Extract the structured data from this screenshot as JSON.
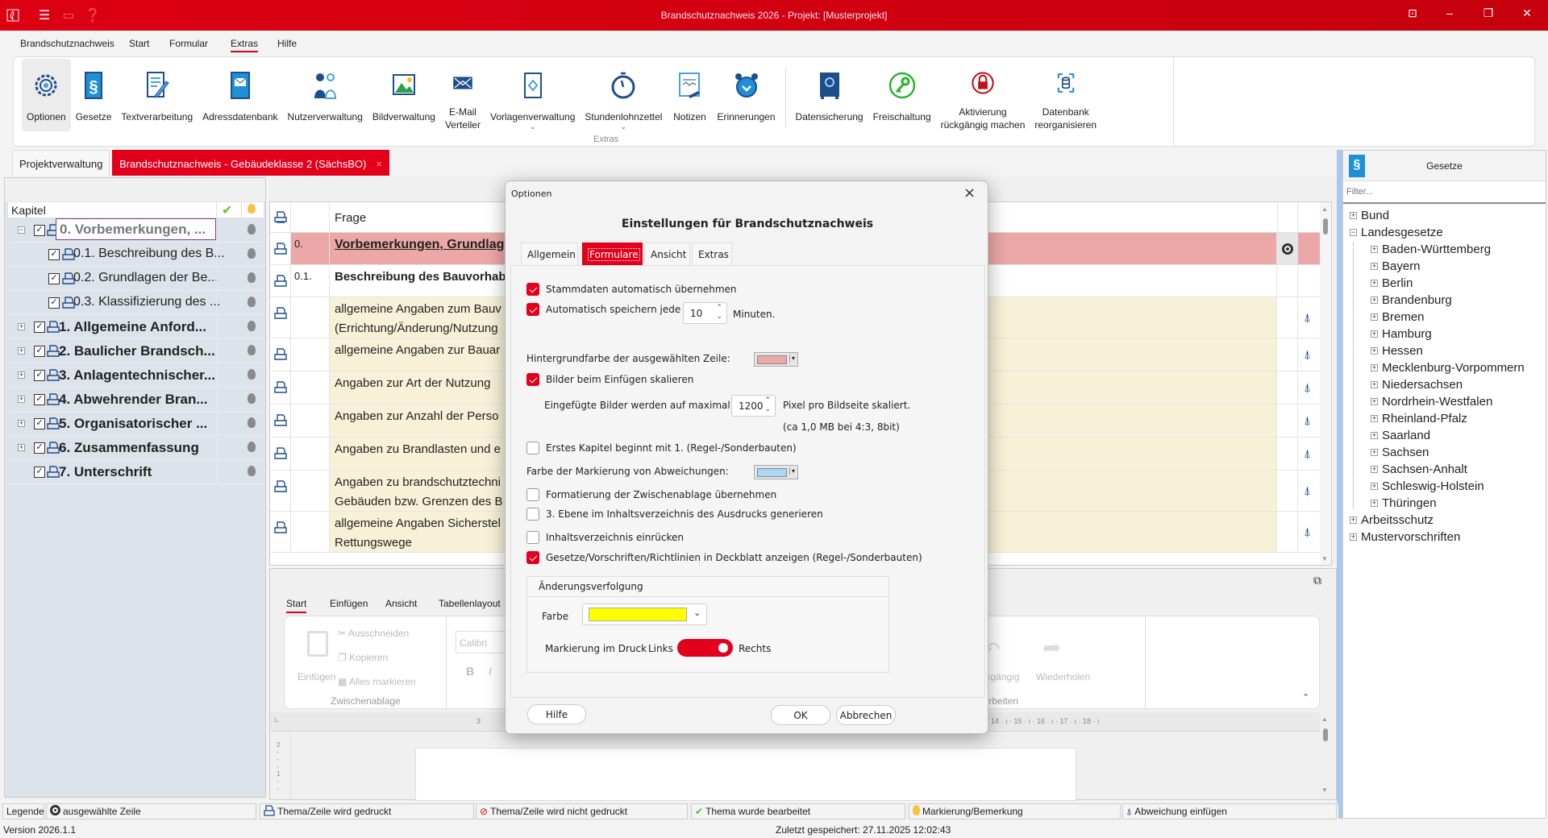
{
  "app": {
    "title": "Brandschutznachweis 2026 - Projekt: [Musterprojekt]",
    "quick_access": [
      "app-logo-icon",
      "menu-icon",
      "save-icon",
      "help-icon"
    ]
  },
  "menu": [
    "Brandschutznachweis",
    "Start",
    "Formular",
    "Extras",
    "Hilfe"
  ],
  "menu_active": "Extras",
  "ribbon": {
    "group_label": "Extras",
    "buttons": [
      {
        "label": "Optionen",
        "icon": "gear-icon",
        "selected": true
      },
      {
        "label": "Gesetze",
        "icon": "paragraph-icon"
      },
      {
        "label": "Textverarbeitung",
        "icon": "document-edit-icon"
      },
      {
        "label": "Adressdatenbank",
        "icon": "address-book-icon"
      },
      {
        "label": "Nutzerverwaltung",
        "icon": "users-icon"
      },
      {
        "label": "Bildverwaltung",
        "icon": "image-icon"
      },
      {
        "label": "E-Mail",
        "label2": "Verteiler",
        "icon": "mail-icon"
      },
      {
        "label": "Vorlagenverwaltung",
        "icon": "template-icon",
        "dropdown": true
      },
      {
        "label": "Stundenlohnzettel",
        "icon": "stopwatch-icon",
        "dropdown": true
      },
      {
        "label": "Notizen",
        "icon": "notes-icon"
      },
      {
        "label": "Erinnerungen",
        "icon": "alarm-icon",
        "separator_after": true
      },
      {
        "label": "Datensicherung",
        "icon": "safe-icon"
      },
      {
        "label": "Freischaltung",
        "icon": "key-icon"
      },
      {
        "label": "Aktivierung",
        "label2": "rückgängig machen",
        "icon": "lock-icon"
      },
      {
        "label": "Datenbank",
        "label2": "reorganisieren",
        "icon": "database-icon"
      }
    ]
  },
  "doc_tabs": [
    {
      "label": "Projektverwaltung"
    },
    {
      "label": "Brandschutznachweis - Gebäudeklasse 2 (SächsBO)",
      "active": true,
      "close": "×"
    }
  ],
  "chapters": {
    "header": "Kapitel",
    "items": [
      {
        "label": "0. Vorbemerkungen, ...",
        "level": 0,
        "expander": "−",
        "bold": true,
        "selected": true
      },
      {
        "label": "0.1. Beschreibung des B...",
        "level": 1
      },
      {
        "label": "0.2. Grundlagen der Be...",
        "level": 1
      },
      {
        "label": "0.3. Klassifizierung des ...",
        "level": 1
      },
      {
        "label": "1. Allgemeine Anford...",
        "level": 0,
        "expander": "+",
        "bold": true
      },
      {
        "label": "2. Baulicher Brandsch...",
        "level": 0,
        "expander": "+",
        "bold": true
      },
      {
        "label": "3. Anlagentechnischer...",
        "level": 0,
        "expander": "+",
        "bold": true
      },
      {
        "label": "4. Abwehrender Bran...",
        "level": 0,
        "expander": "+",
        "bold": true
      },
      {
        "label": "5. Organisatorischer ...",
        "level": 0,
        "expander": "+",
        "bold": true
      },
      {
        "label": "6. Zusammenfassung",
        "level": 0,
        "expander": "+",
        "bold": true
      },
      {
        "label": "7. Unterschrift",
        "level": 0,
        "bold": true
      }
    ]
  },
  "table": {
    "header": "Frage",
    "rows": [
      {
        "num": "0.",
        "lines": [
          "Vorbemerkungen, Grundlag"
        ],
        "style": "selected",
        "marker": true
      },
      {
        "num": "0.1.",
        "lines": [
          "Beschreibung des Bauvorhab"
        ],
        "style": "bold"
      },
      {
        "num": "",
        "lines": [
          "allgemeine Angaben zum Bauv",
          "(Errichtung/Änderung/Nutzung"
        ],
        "style": "yellow",
        "abw": true
      },
      {
        "num": "",
        "lines": [
          "allgemeine Angaben zur Bauar"
        ],
        "style": "yellow",
        "abw": true
      },
      {
        "num": "",
        "lines": [
          "Angaben zur Art der Nutzung"
        ],
        "style": "yellow",
        "abw": true
      },
      {
        "num": "",
        "lines": [
          "Angaben zur Anzahl der Perso"
        ],
        "style": "yellow",
        "abw": true
      },
      {
        "num": "",
        "lines": [
          "Angaben zu Brandlasten und e"
        ],
        "style": "yellow",
        "abw": true
      },
      {
        "num": "",
        "lines": [
          "Angaben zu brandschutztechni",
          "Gebäuden bzw. Grenzen des B"
        ],
        "style": "yellow",
        "abw": true
      },
      {
        "num": "",
        "lines": [
          "allgemeine Angaben Sicherstel",
          "Rettungswege"
        ],
        "style": "yellow",
        "abw": true
      }
    ]
  },
  "editor": {
    "tabs": [
      "Start",
      "Einfügen",
      "Ansicht",
      "Tabellenlayout"
    ],
    "paste": "Einfügen",
    "cut": "Ausschneiden",
    "copy": "Kopieren",
    "select_all": "Alles markieren",
    "clipboard_group": "Zwischenablage",
    "font": "Calibri",
    "bold": "B",
    "italic": "I",
    "undo": "Rückgängig",
    "redo": "Wiederholen",
    "edit_group": "Bearbeiten",
    "ruler_left": "3",
    "ruler_right": "14 · ı · 15 · ı · 16 · ı · 17 · ı · 18 · ı"
  },
  "laws": {
    "header": "Gesetze",
    "filter_placeholder": "Filter...",
    "items": [
      {
        "label": "Bund",
        "level": 0,
        "exp": "+"
      },
      {
        "label": "Landesgesetze",
        "level": 0,
        "exp": "−"
      },
      {
        "label": "Baden-Württemberg",
        "level": 1,
        "exp": "+"
      },
      {
        "label": "Bayern",
        "level": 1,
        "exp": "+"
      },
      {
        "label": "Berlin",
        "level": 1,
        "exp": "+"
      },
      {
        "label": "Brandenburg",
        "level": 1,
        "exp": "+"
      },
      {
        "label": "Bremen",
        "level": 1,
        "exp": "+"
      },
      {
        "label": "Hamburg",
        "level": 1,
        "exp": "+"
      },
      {
        "label": "Hessen",
        "level": 1,
        "exp": "+"
      },
      {
        "label": "Mecklenburg-Vorpommern",
        "level": 1,
        "exp": "+"
      },
      {
        "label": "Niedersachsen",
        "level": 1,
        "exp": "+"
      },
      {
        "label": "Nordrhein-Westfalen",
        "level": 1,
        "exp": "+"
      },
      {
        "label": "Rheinland-Pfalz",
        "level": 1,
        "exp": "+"
      },
      {
        "label": "Saarland",
        "level": 1,
        "exp": "+"
      },
      {
        "label": "Sachsen",
        "level": 1,
        "exp": "+"
      },
      {
        "label": "Sachsen-Anhalt",
        "level": 1,
        "exp": "+"
      },
      {
        "label": "Schleswig-Holstein",
        "level": 1,
        "exp": "+"
      },
      {
        "label": "Thüringen",
        "level": 1,
        "exp": "+"
      },
      {
        "label": "Arbeitsschutz",
        "level": 0,
        "exp": "+"
      },
      {
        "label": "Mustervorschriften",
        "level": 0,
        "exp": "+"
      }
    ]
  },
  "legend": {
    "label": "Legende",
    "items": [
      {
        "label": "ausgewählte Zeile",
        "icon": "selected-row-icon"
      },
      {
        "label": "Thema/Zeile wird gedruckt",
        "icon": "printer-icon"
      },
      {
        "label": "Thema/Zeile wird nicht gedruckt",
        "icon": "no-print-icon"
      },
      {
        "label": "Thema wurde bearbeitet",
        "icon": "checkmark-icon"
      },
      {
        "label": "Markierung/Bemerkung",
        "icon": "bulb-icon"
      },
      {
        "label": "Abweichung einfügen",
        "icon": "deviation-icon"
      }
    ]
  },
  "status": {
    "version": "Version 2026.1.1",
    "saved": "Zuletzt gespeichert: 27.11.2025 12:02:43"
  },
  "dialog": {
    "title": "Optionen",
    "heading": "Einstellungen für Brandschutznachweis",
    "tabs": [
      "Allgemein",
      "Formulare",
      "Ansicht",
      "Extras"
    ],
    "active_tab": "Formulare",
    "stammdaten": {
      "label": "Stammdaten automatisch übernehmen",
      "checked": true
    },
    "autosave": {
      "label": "Automatisch speichern jede",
      "checked": true,
      "value": "10",
      "unit": "Minuten."
    },
    "bg_color": {
      "label": "Hintergrundfarbe der ausgewählten Zeile:",
      "color": "#eba8a6"
    },
    "scale_images": {
      "label": "Bilder beim Einfügen skalieren",
      "checked": true
    },
    "max_pixels": {
      "label": "Eingefügte Bilder werden auf maximal",
      "value": "1200",
      "unit": "Pixel pro Bildseite skaliert.",
      "hint": "(ca 1,0 MB bei 4:3, 8bit)"
    },
    "first_chapter": {
      "label": "Erstes Kapitel beginnt mit 1. (Regel-/Sonderbauten)",
      "checked": false
    },
    "deviation_color": {
      "label": "Farbe der Markierung von Abweichungen:",
      "color": "#a9d6f5"
    },
    "clipboard_format": {
      "label": "Formatierung der Zwischenablage übernehmen",
      "checked": false
    },
    "toc_level3": {
      "label": "3. Ebene im Inhaltsverzeichnis des Ausdrucks generieren",
      "checked": false
    },
    "toc_indent": {
      "label": "Inhaltsverzeichnis einrücken",
      "checked": false
    },
    "laws_cover": {
      "label": "Gesetze/Vorschriften/Richtlinien in Deckblatt anzeigen (Regel-/Sonderbauten)",
      "checked": true
    },
    "tracking": {
      "title": "Änderungsverfolgung",
      "color_label": "Farbe",
      "color": "#ffff00",
      "print_label": "Markierung im Druck",
      "left": "Links",
      "right": "Rechts",
      "toggle_right": true
    },
    "help": "Hilfe",
    "ok": "OK",
    "cancel": "Abbrechen",
    "close": "×"
  },
  "colors": {
    "brand": "#e2001a",
    "selected_row": "#eba8a6",
    "yellow_row": "#f8f1d8",
    "icon_blue": "#1f4e8c"
  }
}
